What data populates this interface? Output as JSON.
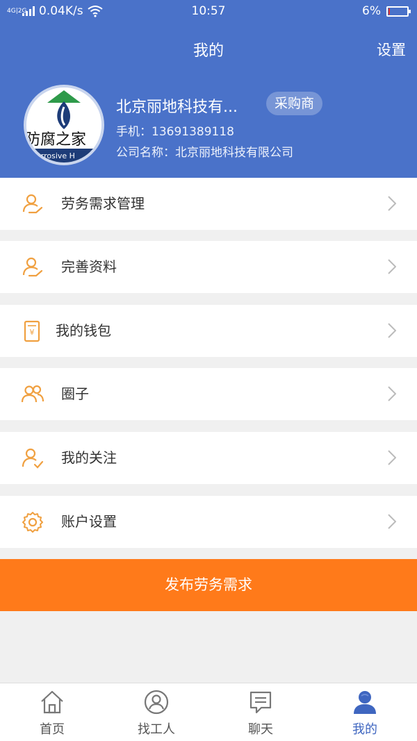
{
  "status_bar": {
    "network": "4G|2G",
    "speed": "0.04K/s",
    "time": "10:57",
    "battery": "6%",
    "battery_level": 0.06
  },
  "header": {
    "title": "我的",
    "settings_label": "设置"
  },
  "profile": {
    "avatar_text": "防腐之家",
    "avatar_subtext": "corrosive H",
    "name": "北京丽地科技有...",
    "role_badge": "采购商",
    "phone": "手机：13691389118",
    "company": "公司名称：北京丽地科技有限公司"
  },
  "menu": [
    {
      "label": "劳务需求管理",
      "icon": "person-hand-icon"
    },
    {
      "label": "完善资料",
      "icon": "person-hand-icon"
    },
    {
      "label": "我的钱包",
      "icon": "wallet-icon"
    },
    {
      "label": "圈子",
      "icon": "group-icon"
    },
    {
      "label": "我的关注",
      "icon": "person-check-icon"
    },
    {
      "label": "账户设置",
      "icon": "gear-icon"
    }
  ],
  "publish_button": "发布劳务需求",
  "tabs": [
    {
      "label": "首页",
      "icon": "home-icon",
      "active": false
    },
    {
      "label": "找工人",
      "icon": "find-worker-icon",
      "active": false
    },
    {
      "label": "聊天",
      "icon": "chat-icon",
      "active": false
    },
    {
      "label": "我的",
      "icon": "profile-icon",
      "active": true
    }
  ],
  "colors": {
    "header_bg": "#4a72c9",
    "accent_orange": "#ff7a1a",
    "icon_orange": "#f0a040",
    "tab_active": "#3f66c0"
  }
}
